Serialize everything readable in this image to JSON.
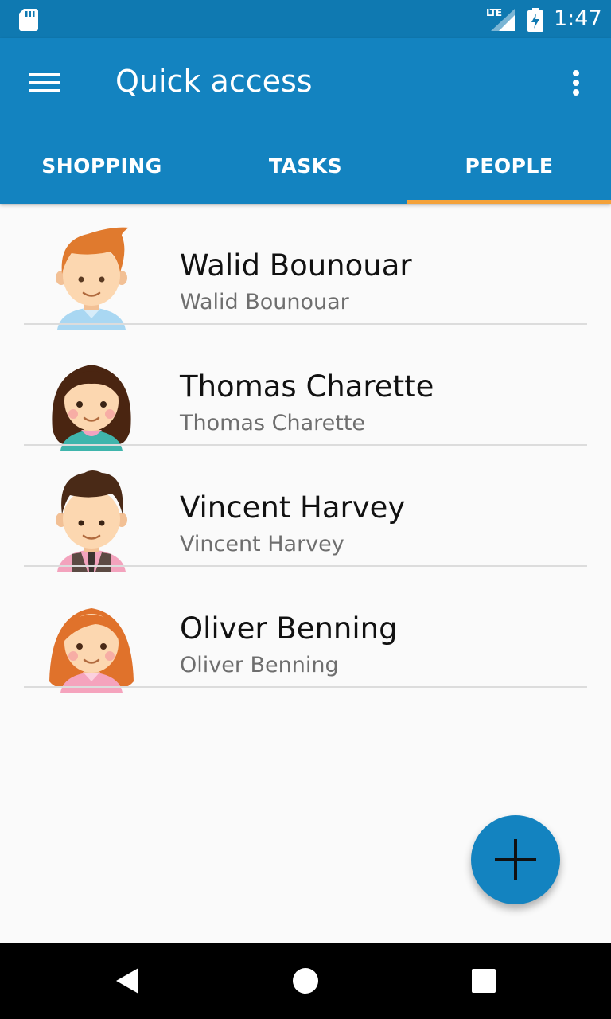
{
  "status_bar": {
    "network": "LTE",
    "time": "1:47"
  },
  "app_bar": {
    "title": "Quick access"
  },
  "tabs": [
    {
      "label": "SHOPPING",
      "selected": false
    },
    {
      "label": "TASKS",
      "selected": false
    },
    {
      "label": "PEOPLE",
      "selected": true
    }
  ],
  "people": [
    {
      "name": "Walid Bounouar",
      "subtitle": "Walid Bounouar",
      "avatar": "boy-orange-hair-avatar"
    },
    {
      "name": "Thomas Charette",
      "subtitle": "Thomas Charette",
      "avatar": "girl-brown-hair-avatar"
    },
    {
      "name": "Vincent Harvey",
      "subtitle": "Vincent Harvey",
      "avatar": "boy-brown-hair-avatar"
    },
    {
      "name": "Oliver Benning",
      "subtitle": "Oliver Benning",
      "avatar": "girl-orange-hair-avatar"
    }
  ],
  "fab": {
    "icon": "plus-icon"
  },
  "colors": {
    "status_bar": "#0f79b1",
    "app_bar": "#1383c0",
    "tab_indicator": "#f4a23a",
    "background": "#fafafa"
  }
}
